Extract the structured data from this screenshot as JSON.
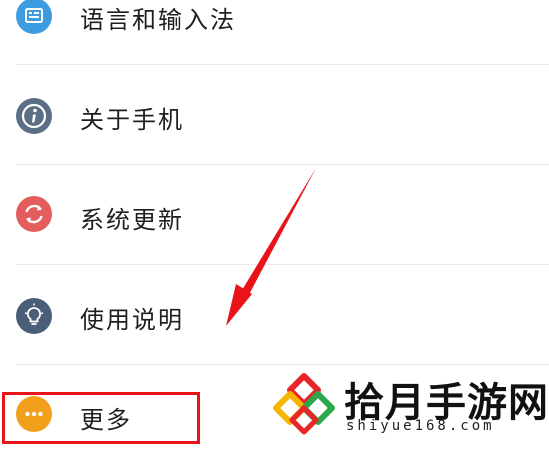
{
  "settings_list": {
    "items": [
      {
        "label": "语言和输入法",
        "icon": "language-input-icon",
        "color": "#3d9be0"
      },
      {
        "label": "关于手机",
        "icon": "info-icon",
        "color": "#5b6e86"
      },
      {
        "label": "系统更新",
        "icon": "system-update-icon",
        "color": "#e35d5d"
      },
      {
        "label": "使用说明",
        "icon": "lightbulb-icon",
        "color": "#4a5e78"
      },
      {
        "label": "更多",
        "icon": "more-dots-icon",
        "color": "#f2a01c"
      }
    ]
  },
  "annotation": {
    "highlight_color": "#e8141a"
  },
  "watermark": {
    "title": "拾月手游网",
    "subtitle": "shiyue168.com"
  }
}
